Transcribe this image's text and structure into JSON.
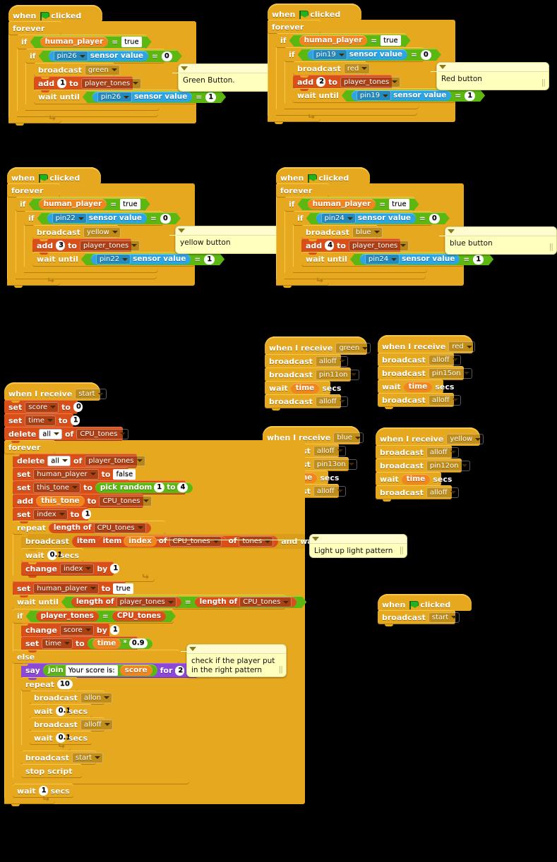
{
  "editor": {
    "name": "scratch-block-editor",
    "background": "#000000"
  },
  "palette": {
    "control": "#e6a81e",
    "data": "#d84f19",
    "variable": "#f0861e",
    "sensing": "#2ca5e2",
    "operator": "#5cb712",
    "looks": "#8c49d6",
    "comment": "#ffffbe"
  },
  "words": {
    "when": "when",
    "clicked": "clicked",
    "when_i_receive": "when I receive",
    "forever": "forever",
    "if": "if",
    "else": "else",
    "repeat": "repeat",
    "broadcast": "broadcast",
    "broadcast_and_wait_suffix": "and wait",
    "wait": "wait",
    "secs": "secs",
    "wait_until": "wait until",
    "add": "add",
    "to": "to",
    "set": "set",
    "change": "change",
    "by": "by",
    "delete": "delete",
    "of": "of",
    "length_of": "length of",
    "item": "item",
    "say": "say",
    "for": "for",
    "join": "join",
    "pick_random": "pick random",
    "stop_script": "stop script",
    "sensor_value": "sensor value",
    "equals": "=",
    "times": "*",
    "all": "all"
  },
  "button_scripts": [
    {
      "id": "green-button-script",
      "color_name": "green",
      "pin": "pin26",
      "tone_number": "1",
      "condition_value": "0",
      "wait_value": "1",
      "variable": "human_player",
      "variable_value": "true",
      "list": "player_tones",
      "comment": "Green Button."
    },
    {
      "id": "red-button-script",
      "color_name": "red",
      "pin": "pin19",
      "tone_number": "2",
      "condition_value": "0",
      "wait_value": "1",
      "variable": "human_player",
      "variable_value": "true",
      "list": "player_tones",
      "comment": "Red button"
    },
    {
      "id": "yellow-button-script",
      "color_name": "yellow",
      "pin": "pin22",
      "tone_number": "3",
      "condition_value": "0",
      "wait_value": "1",
      "variable": "human_player",
      "variable_value": "true",
      "list": "player_tones",
      "comment": "yellow button"
    },
    {
      "id": "blue-button-script",
      "color_name": "blue",
      "pin": "pin24",
      "tone_number": "4",
      "condition_value": "0",
      "wait_value": "1",
      "variable": "human_player",
      "variable_value": "true",
      "list": "player_tones",
      "comment": "blue button"
    }
  ],
  "receive_scripts": [
    {
      "id": "receive-green",
      "message": "green",
      "off": "alloff",
      "on": "pin11on",
      "wait_var": "time"
    },
    {
      "id": "receive-red",
      "message": "red",
      "off": "alloff",
      "on": "pin15on",
      "wait_var": "time"
    },
    {
      "id": "receive-blue",
      "message": "blue",
      "off": "alloff",
      "on": "pin13on",
      "wait_var": "time"
    },
    {
      "id": "receive-yellow",
      "message": "yellow",
      "off": "alloff",
      "on": "pin12on",
      "wait_var": "time"
    }
  ],
  "main_script": {
    "hat_message": "start",
    "set_score_var": "score",
    "set_score_val": "0",
    "set_time_var": "time",
    "set_time_val": "1",
    "delete_all": "all",
    "delete_cpu_list": "CPU_tones",
    "delete_player_list": "player_tones",
    "set_human_var": "human_player",
    "set_human_false": "false",
    "set_human_true": "true",
    "set_thistone_var": "this_tone",
    "pick_random_from": "1",
    "pick_random_to": "4",
    "add_var": "this_tone",
    "add_list": "CPU_tones",
    "set_index_var": "index",
    "set_index_val": "1",
    "repeat_list": "CPU_tones",
    "broadcast_item_index": "index",
    "broadcast_item_list": "CPU_tones",
    "broadcast_item_of": "tones",
    "wait_short": "0.1",
    "change_index_var": "index",
    "change_index_by": "1",
    "wait_until_left_list": "player_tones",
    "wait_until_right_list": "CPU_tones",
    "if_left_list": "player_tones",
    "if_right_list": "CPU_tones",
    "change_score_var": "score",
    "change_score_by": "1",
    "set_time2_var": "time",
    "set_time2_left": "time",
    "set_time2_right": "0.9",
    "say_text": "Your score is:",
    "say_var": "score",
    "say_secs": "2",
    "repeat_10": "10",
    "allon": "allon",
    "alloff": "alloff",
    "broadcast_start": "start",
    "bottom_wait": "1",
    "comment_pattern": "Light up light pattern",
    "comment_check": "check if the player put in the right pattern"
  },
  "start_script": {
    "id": "green-flag-start-script",
    "broadcast": "start"
  }
}
